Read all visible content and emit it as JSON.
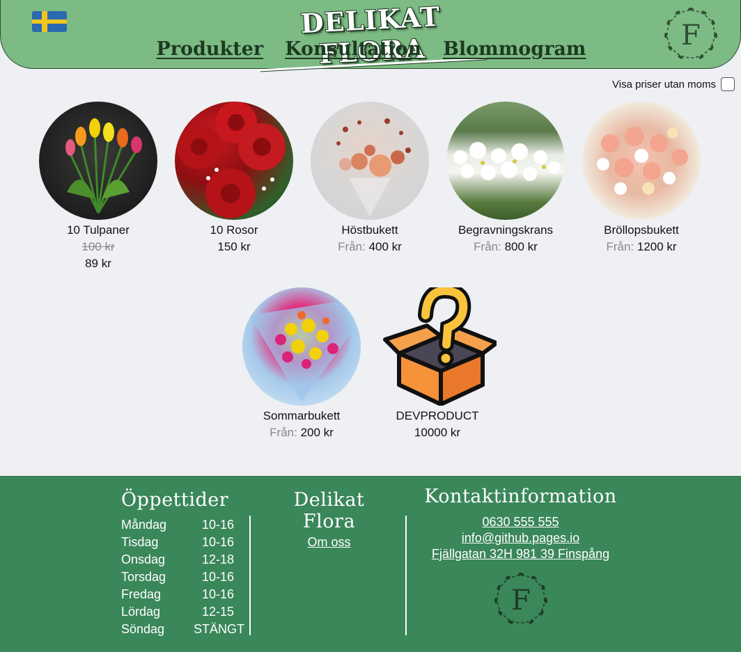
{
  "header": {
    "brand": "DELIKAT FLORA",
    "flag": "sweden-flag",
    "logo_letter": "F",
    "nav": [
      "Produkter",
      "Konsultation",
      "Blommogram"
    ]
  },
  "tax_toggle": {
    "label": "Visa priser utan moms",
    "checked": false
  },
  "products": [
    {
      "name": "10 Tulpaner",
      "old_price": "100 kr",
      "price": "89 kr"
    },
    {
      "name": "10 Rosor",
      "price": "150 kr"
    },
    {
      "name": "Höstbukett",
      "prefix": "Från:",
      "price": "400 kr"
    },
    {
      "name": "Begravningskrans",
      "prefix": "Från:",
      "price": "800 kr"
    },
    {
      "name": "Bröllopsbukett",
      "prefix": "Från:",
      "price": "1200 kr"
    },
    {
      "name": "Sommarbukett",
      "prefix": "Från:",
      "price": "200 kr"
    },
    {
      "name": "DEVPRODUCT",
      "price": "10000 kr"
    }
  ],
  "footer": {
    "hours_title": "Öppettider",
    "hours": [
      {
        "day": "Måndag",
        "time": "10-16"
      },
      {
        "day": "Tisdag",
        "time": "10-16"
      },
      {
        "day": "Onsdag",
        "time": "12-18"
      },
      {
        "day": "Torsdag",
        "time": "10-16"
      },
      {
        "day": "Fredag",
        "time": "10-16"
      },
      {
        "day": "Lördag",
        "time": "12-15"
      },
      {
        "day": "Söndag",
        "time": "STÄNGT"
      }
    ],
    "about_title": "Delikat Flora",
    "about_link": "Om oss",
    "contact_title": "Kontaktinformation",
    "phone": "0630 555 555",
    "email": "info@github.pages.io",
    "address": "Fjällgatan 32H 981 39 Finspång",
    "logo_letter": "F"
  }
}
